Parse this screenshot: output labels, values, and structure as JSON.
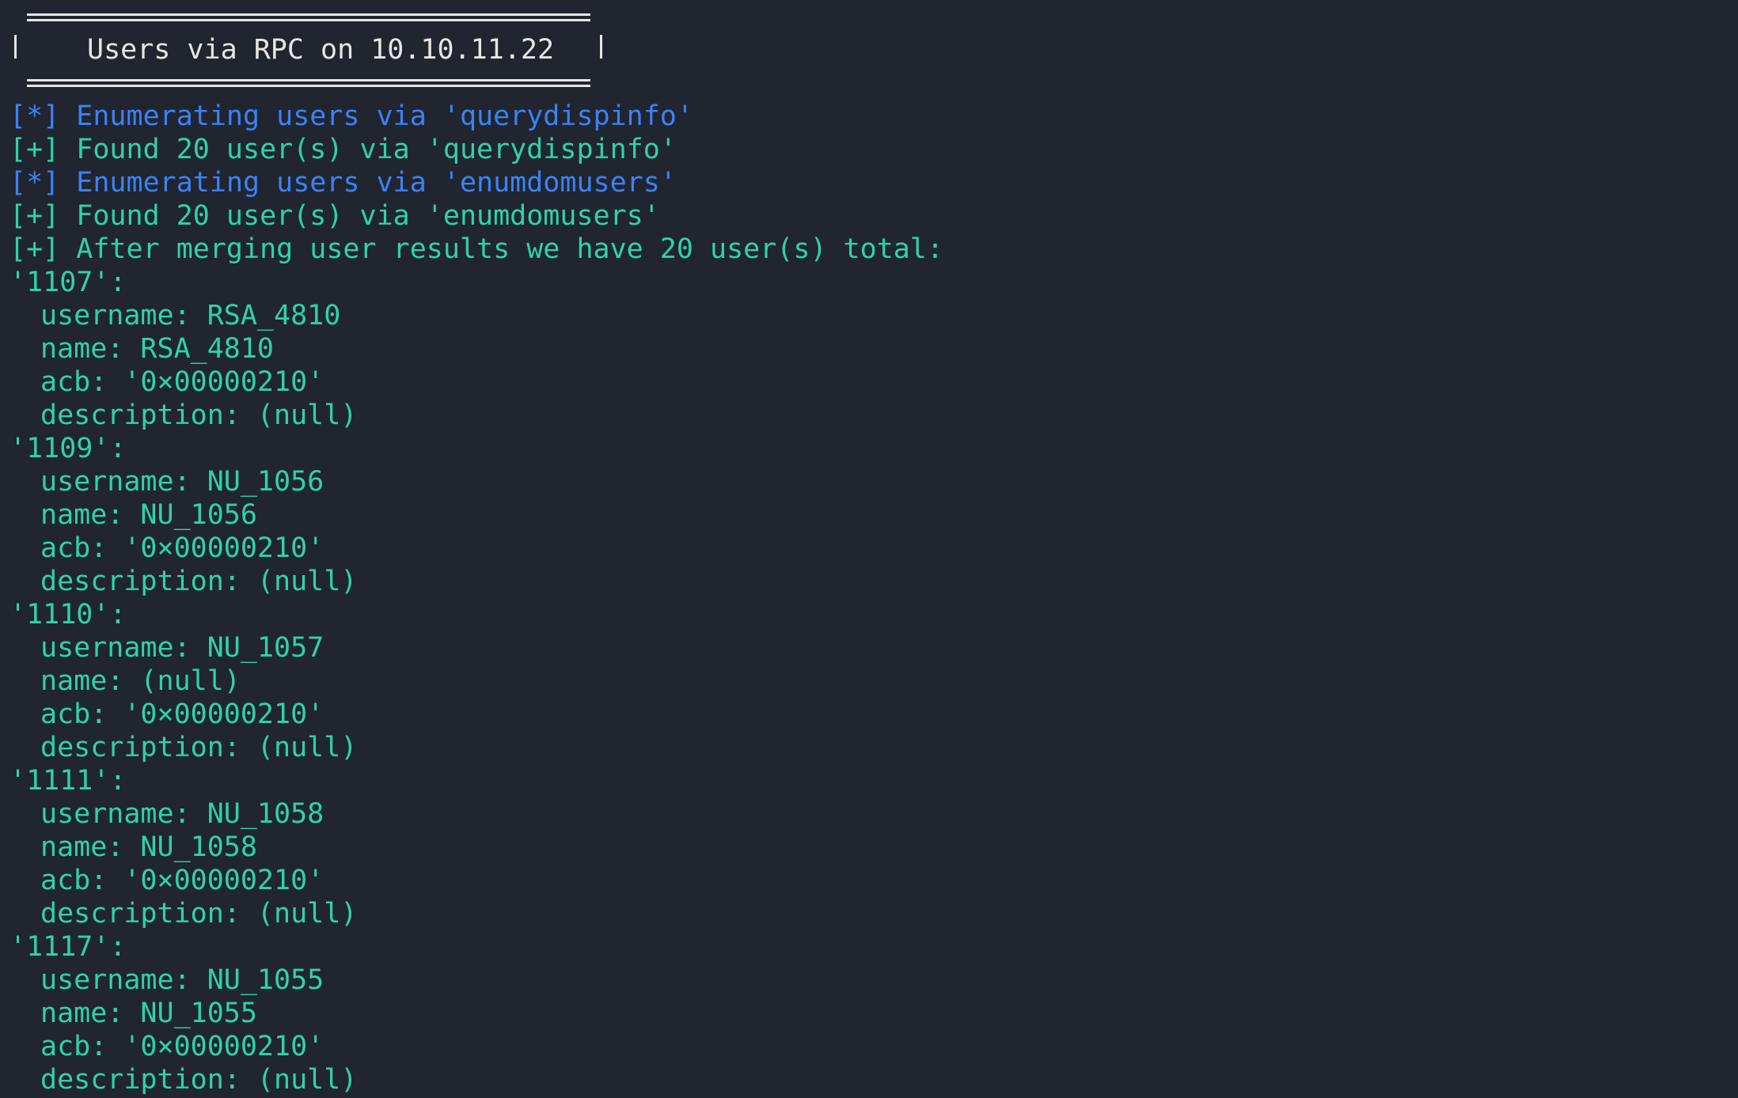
{
  "banner": {
    "title": "Users via RPC on 10.10.11.22"
  },
  "log": [
    {
      "text": "[*] Enumerating users via 'querydispinfo'",
      "kind": "info"
    },
    {
      "text": "[+] Found 20 user(s) via 'querydispinfo'",
      "kind": "ok"
    },
    {
      "text": "[*] Enumerating users via 'enumdomusers'",
      "kind": "info"
    },
    {
      "text": "[+] Found 20 user(s) via 'enumdomusers'",
      "kind": "ok"
    },
    {
      "text": "[+] After merging user results we have 20 user(s) total:",
      "kind": "ok"
    }
  ],
  "users": [
    {
      "rid": "'1107':",
      "username": "username: RSA_4810",
      "name": "name: RSA_4810",
      "acb": "acb: '0×00000210'",
      "description": "description: (null)"
    },
    {
      "rid": "'1109':",
      "username": "username: NU_1056",
      "name": "name: NU_1056",
      "acb": "acb: '0×00000210'",
      "description": "description: (null)"
    },
    {
      "rid": "'1110':",
      "username": "username: NU_1057",
      "name": "name: (null)",
      "acb": "acb: '0×00000210'",
      "description": "description: (null)"
    },
    {
      "rid": "'1111':",
      "username": "username: NU_1058",
      "name": "name: NU_1058",
      "acb": "acb: '0×00000210'",
      "description": "description: (null)"
    },
    {
      "rid": "'1117':",
      "username": "username: NU_1055",
      "name": "name: NU_1055",
      "acb": "acb: '0×00000210'",
      "description": "description: (null)"
    }
  ],
  "colors": {
    "background": "#21252f",
    "info": "#3b82f6",
    "ok": "#2ed3a7",
    "banner": "#e6e6e6"
  }
}
